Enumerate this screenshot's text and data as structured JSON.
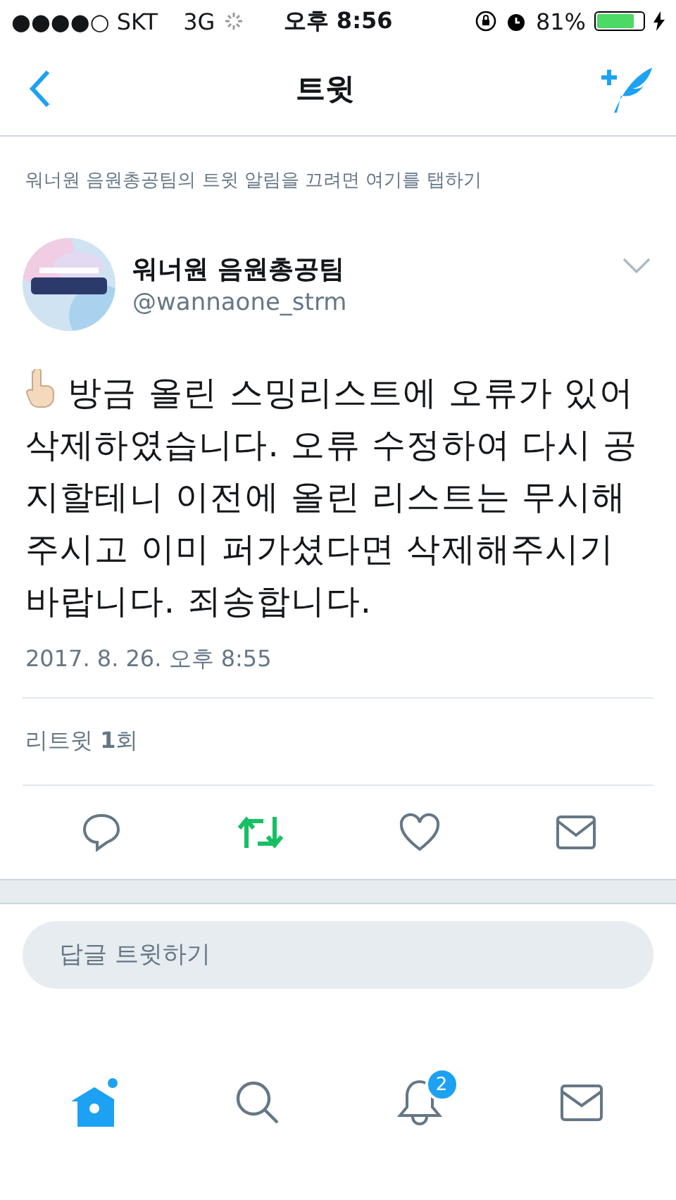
{
  "status_bar": {
    "carrier": "●●●●○ SKT",
    "network": "3G",
    "time": "오후 8:56",
    "battery": "81%",
    "battery_meter": {
      "level": 0.81
    }
  },
  "nav": {
    "title": "트윗"
  },
  "notice": "워너원 음원총공팀의 트윗 알림을 끄려면 여기를 탭하기",
  "tweet": {
    "name": "워너원 음원총공팀",
    "handle": "@wannaone_strm",
    "text": "방금 올린 스밍리스트에 오류가 있어 삭제하였습니다. 오류 수정하여 다시 공지할테니 이전에 올린 리스트는 무시해주시고 이미 퍼가셨다면 삭제해주시기 바랍니다. 죄송합니다.",
    "date": "2017. 8. 26. 오후 8:55",
    "retweets": "리트윗 **1**회",
    "retweeted": true,
    "liked": false
  },
  "reply": {
    "placeholder": "답글 트윗하기"
  },
  "tabs": [
    {
      "kind": "home",
      "selected": true
    },
    {
      "kind": "search",
      "selected": false
    },
    {
      "kind": "notifications",
      "selected": false,
      "badge": "2"
    },
    {
      "kind": "messages",
      "selected": false
    }
  ]
}
